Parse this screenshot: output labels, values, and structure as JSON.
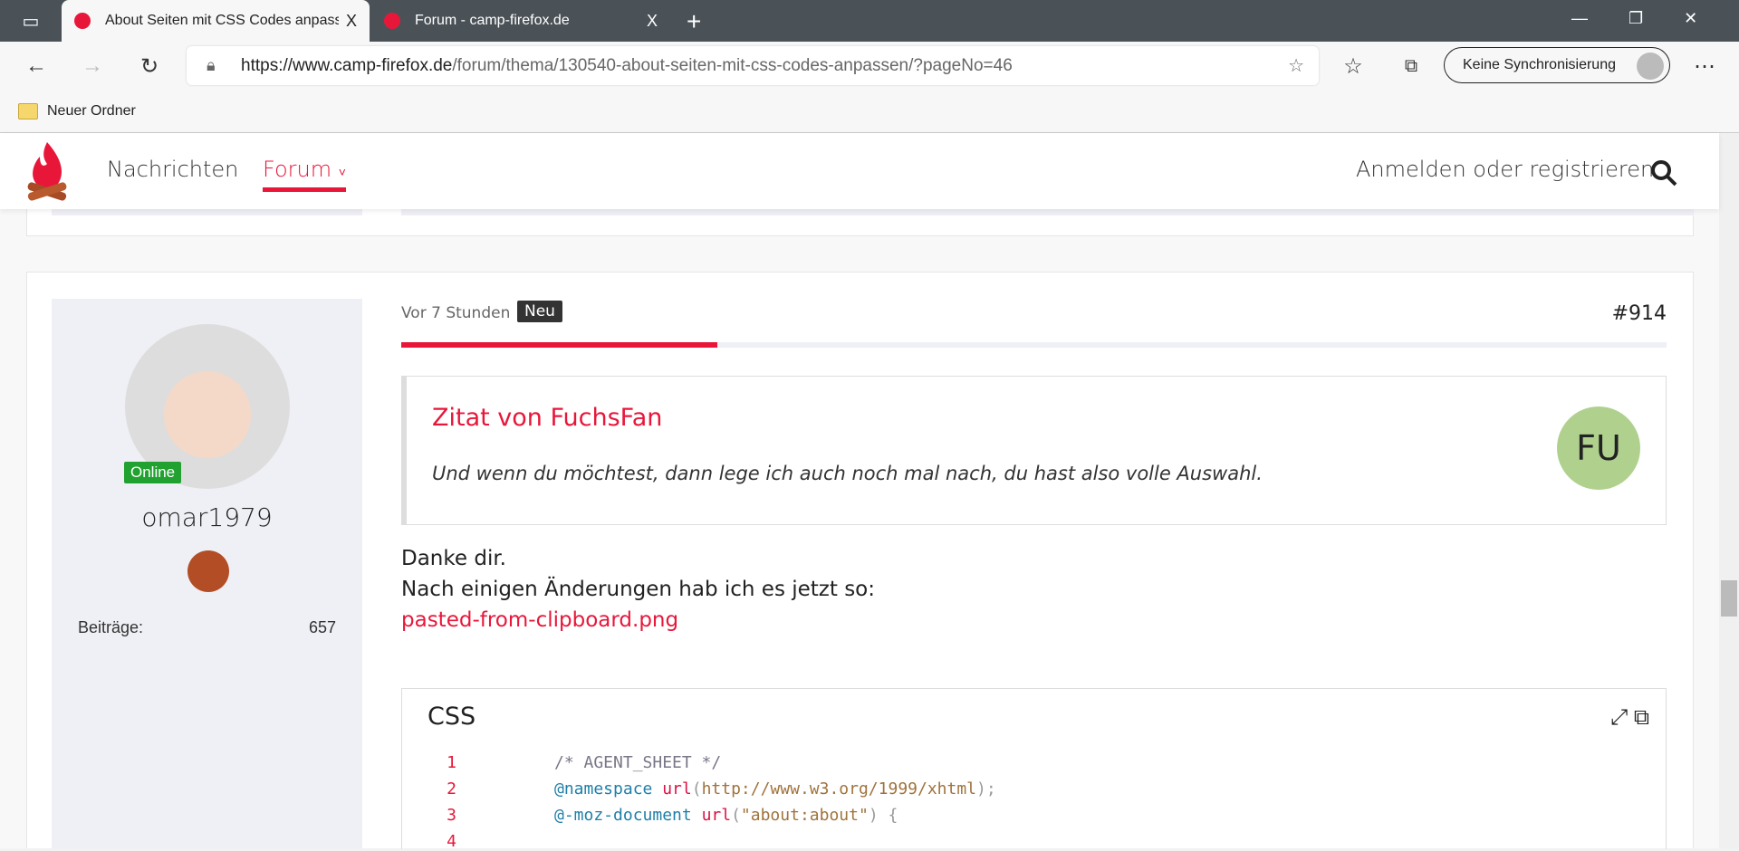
{
  "browser": {
    "tabs": [
      {
        "title": "About Seiten mit CSS Codes anpassen",
        "close": "X"
      },
      {
        "title": "Forum - camp-firefox.de",
        "close": "X"
      }
    ],
    "new_tab": "+",
    "url_host": "https://www.camp-firefox.de",
    "url_path": "/forum/thema/130540-about-seiten-mit-css-codes-anpassen/?pageNo=46",
    "sync_label": "Keine Synchronisierung",
    "bookmark": "Neuer Ordner"
  },
  "site": {
    "nav": [
      "Nachrichten",
      "Forum"
    ],
    "login": "Anmelden oder registrieren"
  },
  "post": {
    "time": "Vor 7 Stunden",
    "badge": "Neu",
    "number": "#914",
    "progress": 0.25,
    "author": {
      "status": "Online",
      "name": "omar1979",
      "stat_label": "Beiträge:",
      "stat_value": "657"
    },
    "quote": {
      "title": "Zitat von FuchsFan",
      "text": "Und wenn du möchtest, dann lege ich auch noch mal nach, du hast also volle Auswahl.",
      "avatar": "FU"
    },
    "lines": [
      "Danke dir.",
      "Nach einigen Änderungen hab ich es jetzt so:"
    ],
    "attachment": "pasted-from-clipboard.png",
    "code": {
      "lang": "CSS",
      "lines": [
        {
          "n": "1",
          "parts": [
            [
              "cm",
              "/* AGENT_SHEET */"
            ]
          ]
        },
        {
          "n": "2",
          "parts": [
            [
              "kw",
              "@namespace "
            ],
            [
              "fn",
              "url"
            ],
            [
              "pn",
              "("
            ],
            [
              "st",
              "http://www.w3.org/1999/xhtml"
            ],
            [
              "pn",
              ");"
            ]
          ]
        },
        {
          "n": "3",
          "parts": [
            [
              "kw",
              "@-moz-document "
            ],
            [
              "fn",
              "url"
            ],
            [
              "pn",
              "("
            ],
            [
              "st",
              "\"about:about\""
            ],
            [
              "pn",
              ") {"
            ]
          ]
        },
        {
          "n": "4",
          "parts": []
        }
      ]
    }
  }
}
